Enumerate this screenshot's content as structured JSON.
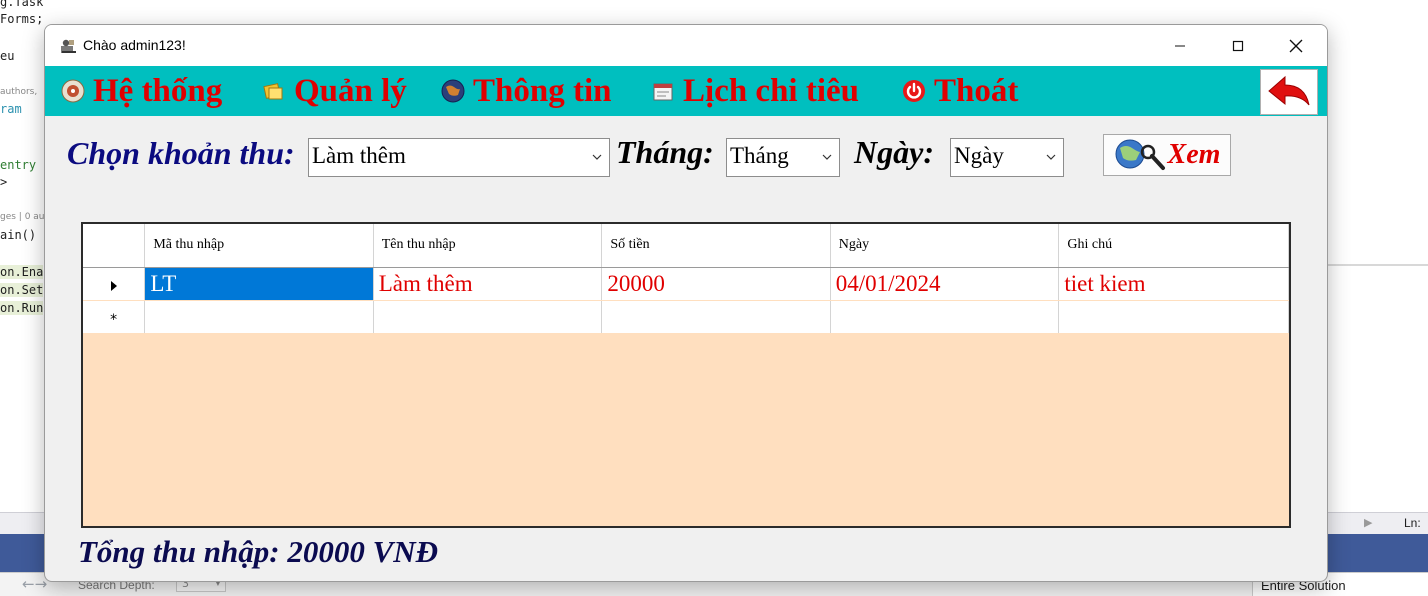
{
  "ide": {
    "code_lines": [
      {
        "text": "g.Tasks;",
        "cls": ""
      },
      {
        "text": "Forms;",
        "cls": ""
      },
      {
        "text": "eu",
        "cls": ""
      },
      {
        "text": "authors,",
        "cls": "small"
      },
      {
        "text": "ram",
        "cls": "kw"
      },
      {
        "text": "entry",
        "cls": "green"
      },
      {
        "text": ">",
        "cls": ""
      },
      {
        "text": "ges | 0 au",
        "cls": "small"
      },
      {
        "text": "ain()",
        "cls": ""
      },
      {
        "text": "on.Ena",
        "cls": "hl"
      },
      {
        "text": "on.Set",
        "cls": "hl"
      },
      {
        "text": "on.Run",
        "cls": "hl"
      }
    ],
    "status_ln": "Ln:",
    "search_depth_label": "Search Depth:",
    "search_depth_value": "3",
    "scope": "Entire Solution"
  },
  "window": {
    "title": "Chào admin123!"
  },
  "menu": {
    "items": [
      {
        "label": "Hệ thống",
        "icon": "disk-icon"
      },
      {
        "label": "Quản lý",
        "icon": "folder-icon"
      },
      {
        "label": "Thông tin",
        "icon": "globe-icon"
      },
      {
        "label": "Lịch chi tiêu",
        "icon": "calendar-icon"
      },
      {
        "label": "Thoát",
        "icon": "power-icon"
      }
    ],
    "back_icon": "back-arrow-icon"
  },
  "filters": {
    "income_label": "Chọn khoản thu:",
    "income_value": "Làm thêm",
    "month_label": "Tháng:",
    "month_value": "Tháng",
    "day_label": "Ngày:",
    "day_value": "Ngày",
    "view_button": "Xem"
  },
  "grid": {
    "columns": [
      "Mã thu nhập",
      "Tên thu nhập",
      "Số tiền",
      "Ngày",
      "Ghi chú"
    ],
    "rows": [
      [
        "LT",
        "Làm thêm",
        "20000",
        "04/01/2024",
        "tiet kiem"
      ]
    ]
  },
  "total": {
    "text": "Tổng thu nhập: 20000 VNĐ"
  },
  "colors": {
    "menu_bg": "#00bfbf",
    "menu_text": "#e00000",
    "grid_bg": "#ffdfbf",
    "selection": "#0078d7",
    "label_navy": "#0b0b80"
  }
}
